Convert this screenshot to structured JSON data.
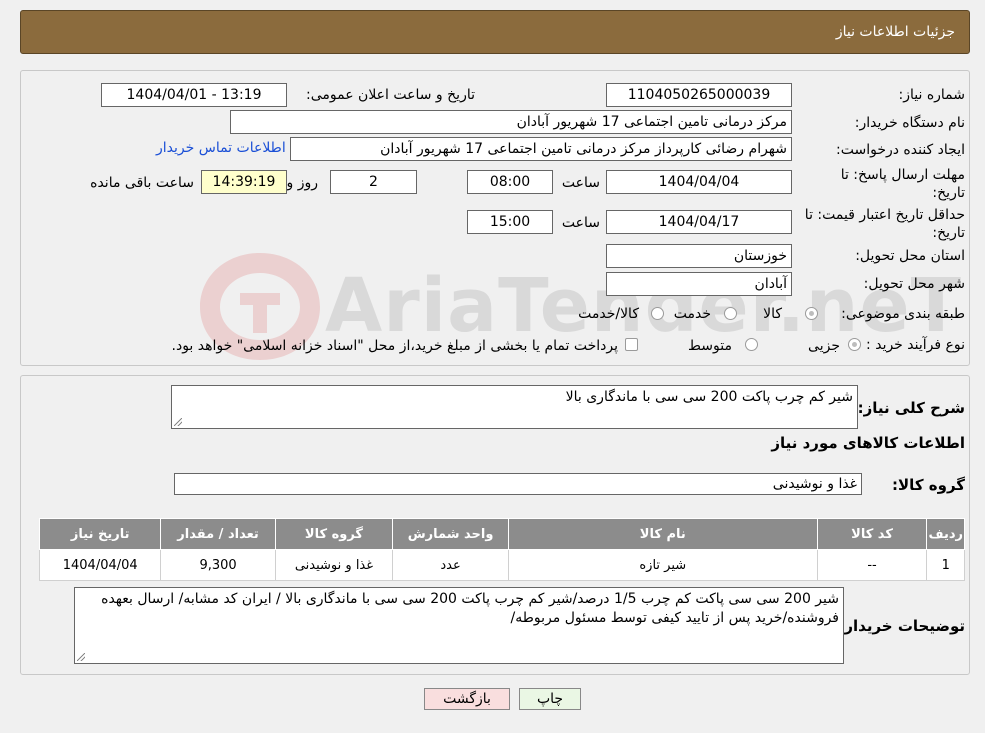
{
  "header": {
    "title": "جزئیات اطلاعات نیاز"
  },
  "form": {
    "need_number_label": "شماره نیاز:",
    "need_number": "1104050265000039",
    "announce_label": "تاریخ و ساعت اعلان عمومی:",
    "announce_value": "1404/04/01 - 13:19",
    "buyer_org_label": "نام دستگاه خریدار:",
    "buyer_org": "مرکز درمانی تامین اجتماعی 17 شهریور آبادان",
    "creator_label": "ایجاد کننده درخواست:",
    "creator": "شهرام رضائی کارپرداز مرکز درمانی تامین اجتماعی 17 شهریور آبادان",
    "contact_link": "اطلاعات تماس خریدار",
    "reply_deadline_label_1": "مهلت ارسال پاسخ: تا",
    "reply_deadline_label_2": "تاریخ:",
    "reply_date": "1404/04/04",
    "time_label": "ساعت",
    "reply_time": "08:00",
    "days": "2",
    "days_label": "روز و",
    "remaining_time": "14:39:19",
    "remaining_label": "ساعت باقی مانده",
    "validity_label_1": "حداقل تاریخ اعتبار قیمت: تا",
    "validity_label_2": "تاریخ:",
    "validity_date": "1404/04/17",
    "validity_time": "15:00",
    "province_label": "استان محل تحویل:",
    "province": "خوزستان",
    "city_label": "شهر محل تحویل:",
    "city": "آبادان",
    "category_label": "طبقه بندی موضوعی:",
    "category_options": [
      "کالا",
      "خدمت",
      "کالا/خدمت"
    ],
    "process_label": "نوع فرآیند خرید :",
    "process_options": [
      "جزیی",
      "متوسط"
    ],
    "process_note": "پرداخت تمام یا بخشی از مبلغ خرید،از محل \"اسناد خزانه اسلامی\" خواهد بود."
  },
  "details": {
    "summary_label": "شرح کلی نیاز:",
    "summary": "شیر کم چرب پاکت 200 سی سی با ماندگاری بالا",
    "goods_info_title": "اطلاعات کالاهای مورد نیاز",
    "goods_group_label": "گروه کالا:",
    "goods_group": "غذا و نوشیدنی",
    "table": {
      "headers": [
        "ردیف",
        "کد کالا",
        "نام کالا",
        "واحد شمارش",
        "گروه کالا",
        "تعداد / مقدار",
        "تاریخ نیاز"
      ],
      "rows": [
        [
          "1",
          "--",
          "شیر تازه",
          "عدد",
          "غذا و نوشیدنی",
          "9,300",
          "1404/04/04"
        ]
      ]
    },
    "buyer_notes_label": "توضیحات خریدار:",
    "buyer_notes": "شیر 200 سی سی  پاکت کم چرب 1/5 درصد/شیر کم چرب پاکت 200 سی سی  با ماندگاری بالا / ایران کد مشابه/ ارسال بعهده  فروشنده/خرید پس از تایید کیفی توسط مسئول مربوطه/"
  },
  "buttons": {
    "print": "چاپ",
    "back": "بازگشت"
  },
  "watermark": {
    "text": "AriaTender.neT"
  },
  "colors": {
    "header": "#8b6b3d",
    "link": "#1a4fd6",
    "print_btn": "#eaf7e4",
    "back_btn": "#f9dede"
  }
}
